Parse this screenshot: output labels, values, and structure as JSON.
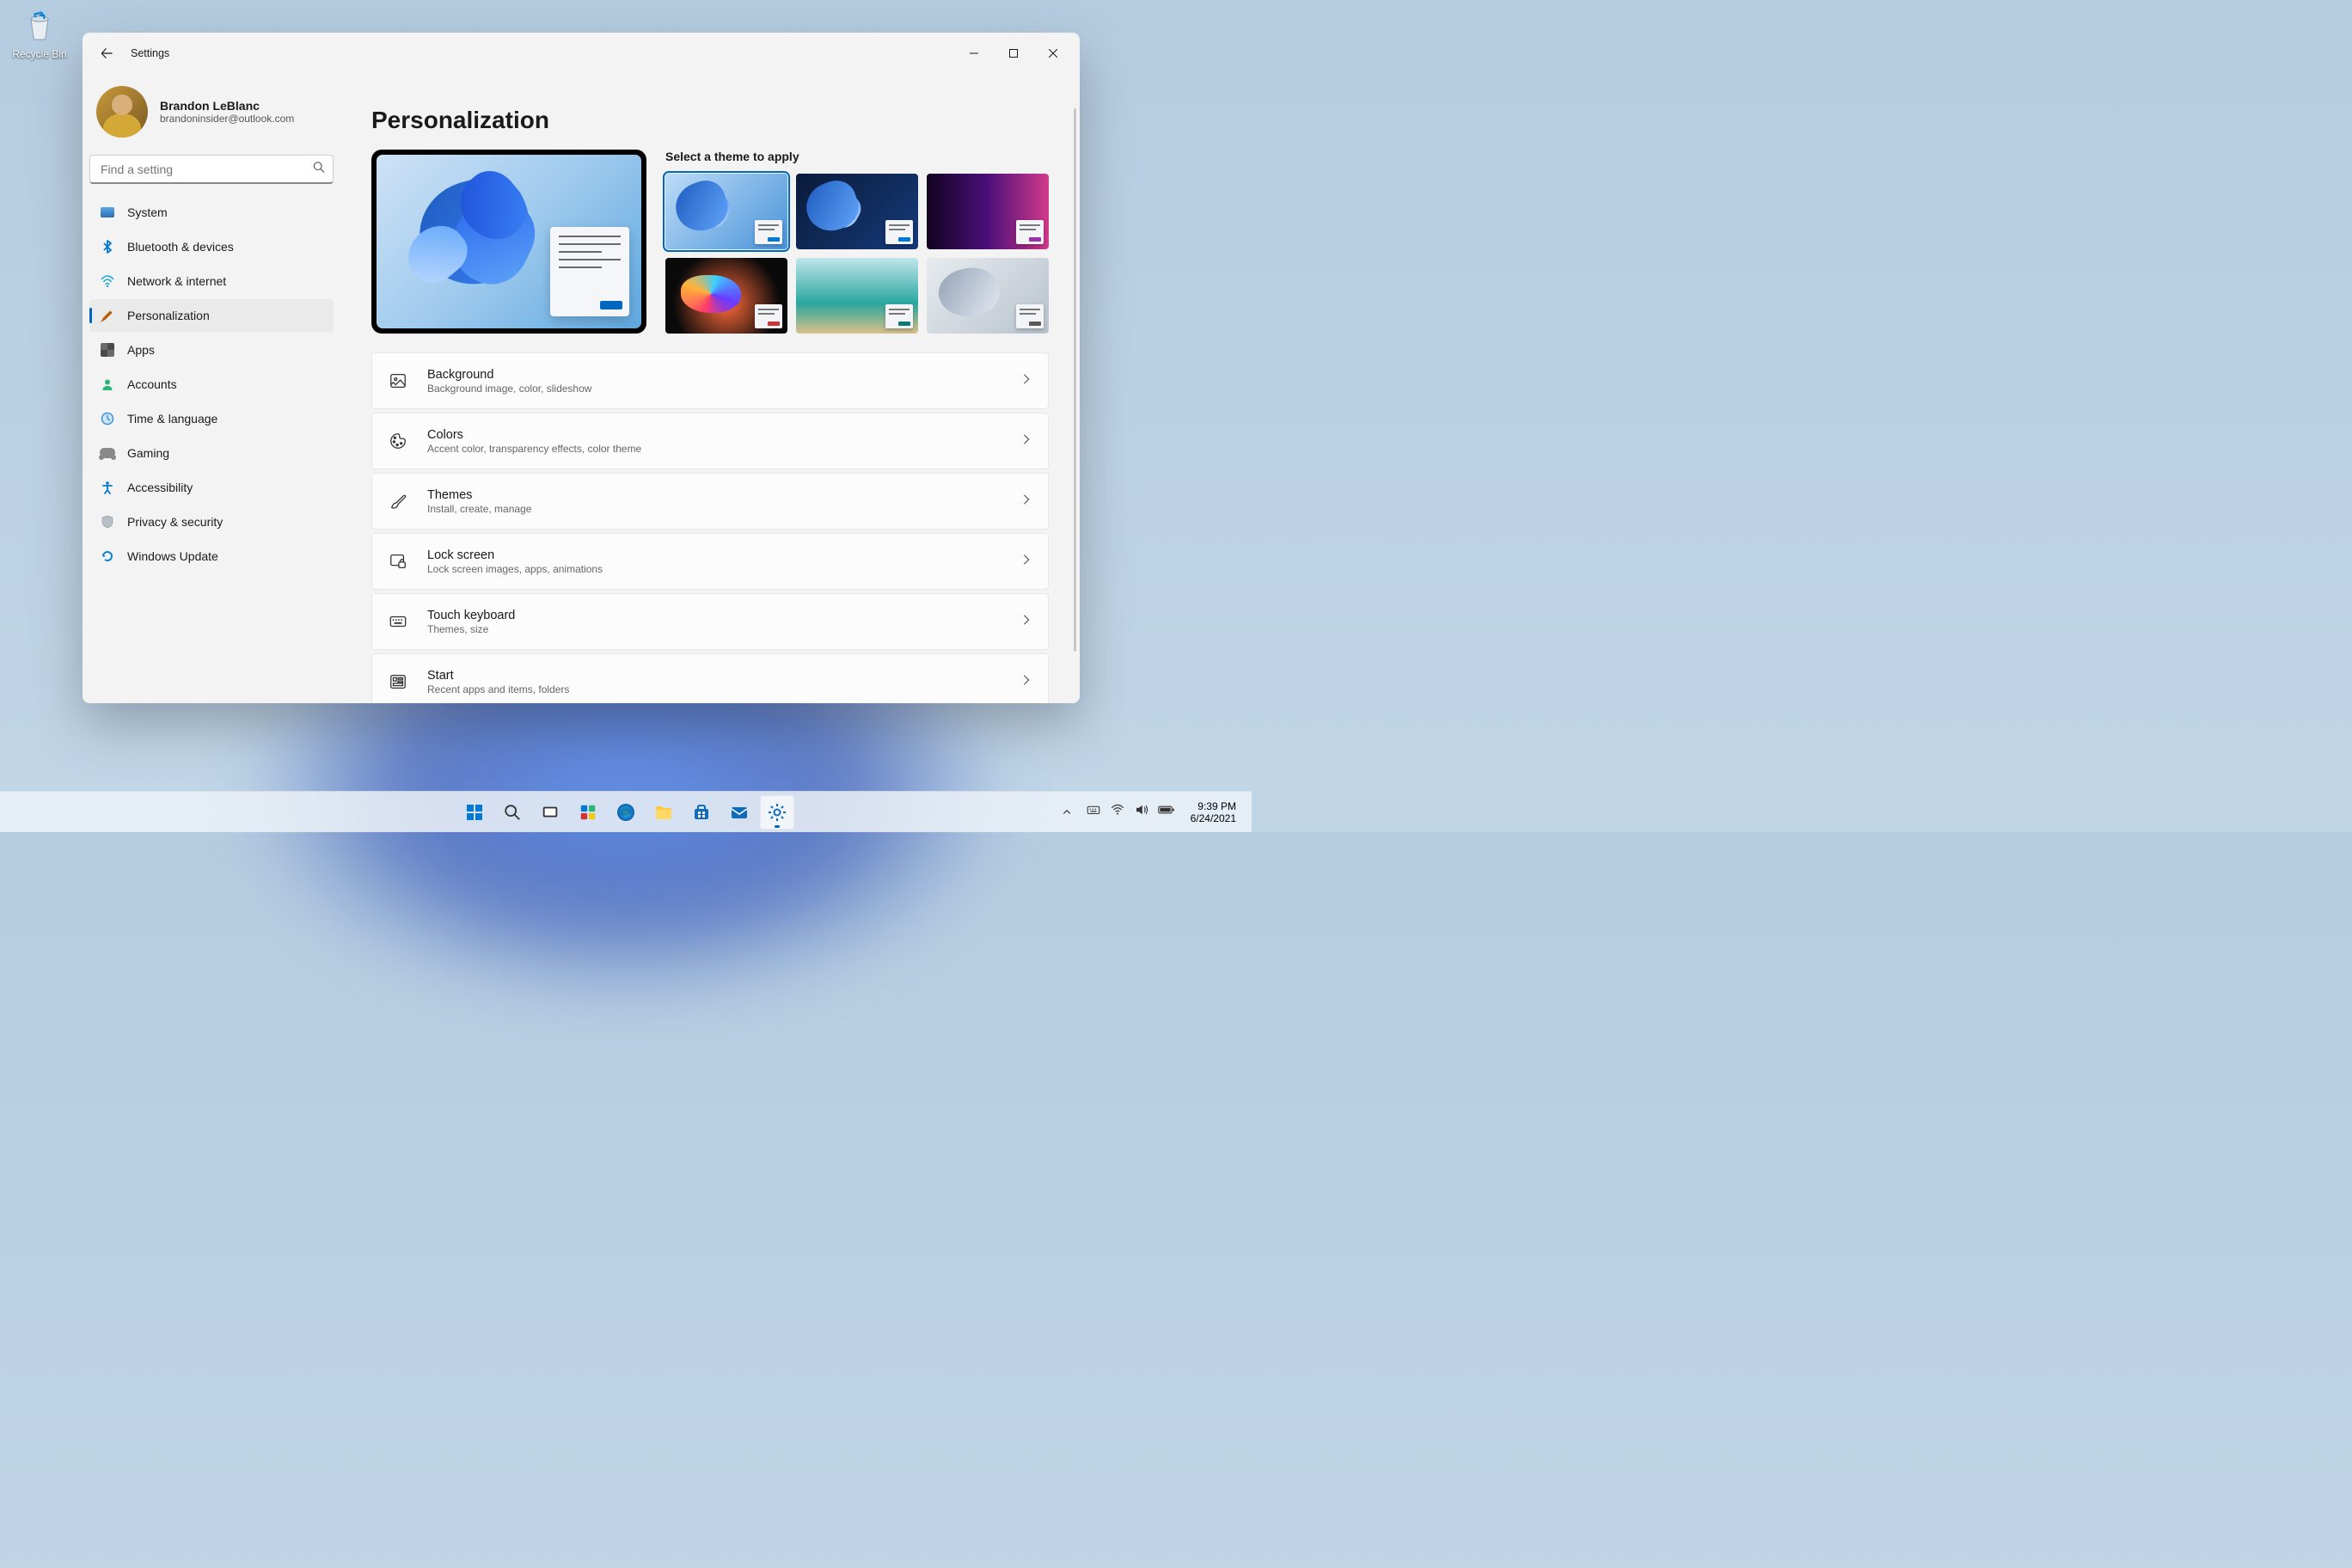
{
  "desktop": {
    "recycle_bin_label": "Recycle Bin"
  },
  "window": {
    "app_title": "Settings"
  },
  "profile": {
    "name": "Brandon LeBlanc",
    "email": "brandoninsider@outlook.com"
  },
  "search": {
    "placeholder": "Find a setting"
  },
  "nav": {
    "system": "System",
    "bluetooth": "Bluetooth & devices",
    "network": "Network & internet",
    "personalization": "Personalization",
    "apps": "Apps",
    "accounts": "Accounts",
    "time": "Time & language",
    "gaming": "Gaming",
    "accessibility": "Accessibility",
    "privacy": "Privacy & security",
    "update": "Windows Update"
  },
  "page": {
    "title": "Personalization",
    "theme_heading": "Select a theme to apply"
  },
  "themes": [
    {
      "accent": "#0078d4",
      "bg": "linear-gradient(135deg,#bcdcf7,#4a93d9)"
    },
    {
      "accent": "#0078d4",
      "bg": "linear-gradient(135deg,#0a1b3a,#163a7a)"
    },
    {
      "accent": "#9b2fae",
      "bg": "linear-gradient(90deg,#120320,#4b0f7a 50%,#d13a8a)"
    },
    {
      "accent": "#d13438",
      "bg": "radial-gradient(circle at 50% 60%,#ff6a3a,#0a0a0a 70%)"
    },
    {
      "accent": "#0b7a75",
      "bg": "linear-gradient(180deg,#bfe6ec 0%,#2aa69f 60%,#d9c08a 100%)"
    },
    {
      "accent": "#5a5a5a",
      "bg": "linear-gradient(135deg,#e8ecef,#b8c2cc)"
    }
  ],
  "cards": {
    "background": {
      "title": "Background",
      "desc": "Background image, color, slideshow"
    },
    "colors": {
      "title": "Colors",
      "desc": "Accent color, transparency effects, color theme"
    },
    "themes": {
      "title": "Themes",
      "desc": "Install, create, manage"
    },
    "lockscreen": {
      "title": "Lock screen",
      "desc": "Lock screen images, apps, animations"
    },
    "touchkb": {
      "title": "Touch keyboard",
      "desc": "Themes, size"
    },
    "start": {
      "title": "Start",
      "desc": "Recent apps and items, folders"
    }
  },
  "taskbar": {
    "time": "9:39 PM",
    "date": "6/24/2021"
  }
}
